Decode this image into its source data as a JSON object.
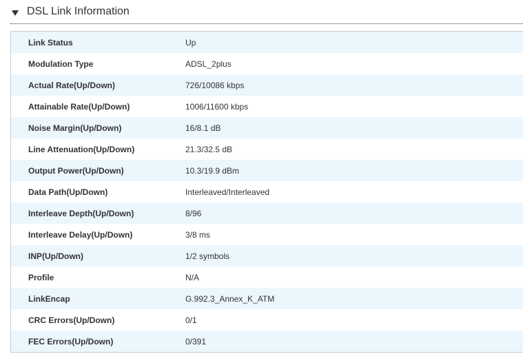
{
  "section": {
    "title": "DSL Link Information"
  },
  "rows": [
    {
      "label": "Link Status",
      "value": "Up"
    },
    {
      "label": "Modulation Type",
      "value": "ADSL_2plus"
    },
    {
      "label": "Actual Rate(Up/Down)",
      "value": "726/10086 kbps"
    },
    {
      "label": "Attainable Rate(Up/Down)",
      "value": "1006/11600 kbps"
    },
    {
      "label": "Noise Margin(Up/Down)",
      "value": "16/8.1 dB"
    },
    {
      "label": "Line Attenuation(Up/Down)",
      "value": "21.3/32.5 dB"
    },
    {
      "label": "Output Power(Up/Down)",
      "value": "10.3/19.9 dBm"
    },
    {
      "label": "Data Path(Up/Down)",
      "value": "Interleaved/Interleaved"
    },
    {
      "label": "Interleave Depth(Up/Down)",
      "value": "8/96"
    },
    {
      "label": "Interleave Delay(Up/Down)",
      "value": "3/8 ms"
    },
    {
      "label": "INP(Up/Down)",
      "value": "1/2 symbols"
    },
    {
      "label": "Profile",
      "value": "N/A"
    },
    {
      "label": "LinkEncap",
      "value": "G.992.3_Annex_K_ATM"
    },
    {
      "label": "CRC Errors(Up/Down)",
      "value": "0/1"
    },
    {
      "label": "FEC Errors(Up/Down)",
      "value": "0/391"
    }
  ]
}
